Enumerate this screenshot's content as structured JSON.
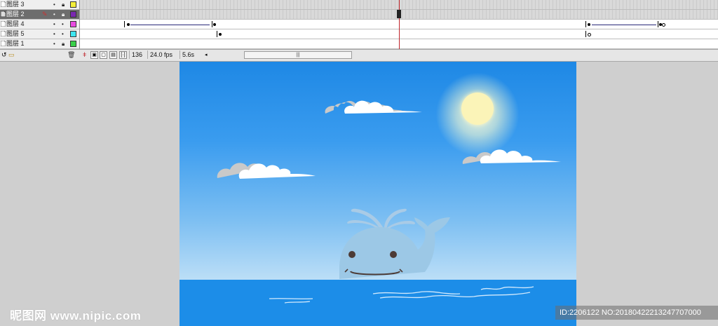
{
  "layers": [
    {
      "name": "图层 3",
      "color": "#f4ef3a",
      "selected": false
    },
    {
      "name": "图层 2",
      "color": "#7a28b0",
      "selected": true
    },
    {
      "name": "图层 4",
      "color": "#e84be0",
      "selected": false
    },
    {
      "name": "图层 5",
      "color": "#3ee6f0",
      "selected": false
    },
    {
      "name": "图层 1",
      "color": "#3ad04a",
      "selected": false
    }
  ],
  "status": {
    "frame": "136",
    "fps": "24.0 fps",
    "time": "5.6s",
    "scroll_grip": "|||"
  },
  "watermark": {
    "left": "昵图网 www.nipic.com",
    "right": "ID:2206122 NO:20180422213247707000"
  },
  "colors": {
    "sky_top": "#1e88e5",
    "sea": "#1c8de8",
    "whale": "#9cc8e6",
    "playhead": "#c0242a"
  }
}
